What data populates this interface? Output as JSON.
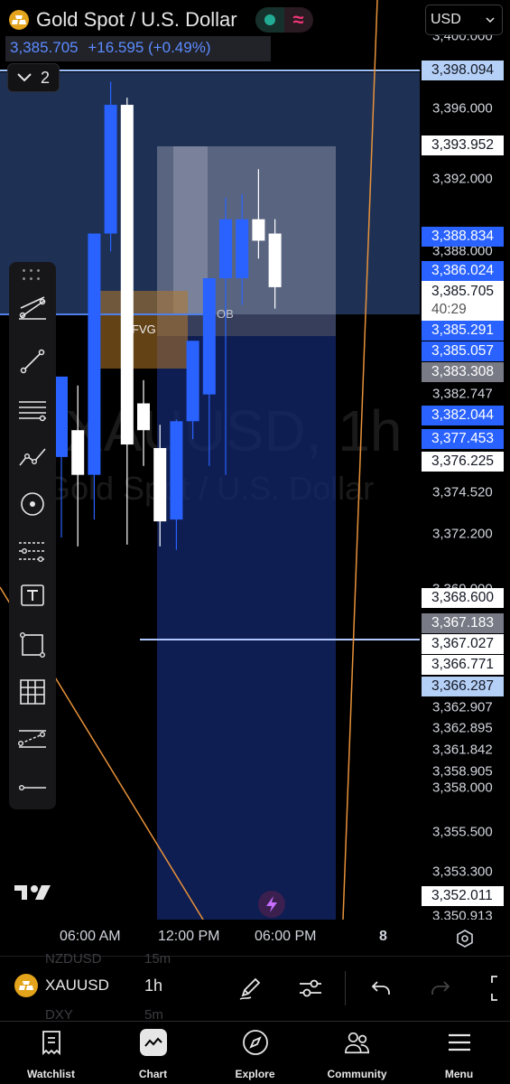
{
  "header": {
    "symbol_title": "Gold Spot / U.S. Dollar",
    "last_price": "3,385.705",
    "change": "+16.595 (+0.49%)",
    "indicator_count": "2",
    "wave_glyph": "≈"
  },
  "currency_select": {
    "value": "USD"
  },
  "watermark": {
    "main": "XAUUSD, 1h",
    "sub": "Gold Spot / U.S. Dollar"
  },
  "annotations": {
    "fvg": "FVG",
    "ob": "OB"
  },
  "price_axis": {
    "ticks": [
      "3,396.000",
      "3,392.000",
      "3,388.000",
      "3,382.747",
      "3,374.520",
      "3,372.200",
      "3,369.000",
      "3,366.000",
      "3,362.907",
      "3,362.895",
      "3,361.842",
      "3,358.905",
      "3,358.000",
      "3,355.500",
      "3,353.300",
      "3,350.913",
      "3,400.000"
    ],
    "tags": [
      "3,398.094",
      "3,393.952",
      "3,388.834",
      "3,386.024",
      "3,385.291",
      "3,385.057",
      "3,383.308",
      "3,382.044",
      "3,377.453",
      "3,376.225",
      "3,368.600",
      "3,367.183",
      "3,367.027",
      "3,366.771",
      "3,366.287",
      "3,352.011"
    ],
    "current_price": "3,385.705",
    "countdown": "40:29"
  },
  "time_axis": {
    "labels": [
      "06:00 AM",
      "12:00 PM",
      "06:00 PM"
    ],
    "date_marker": "8"
  },
  "bottom_toolbar": {
    "symbol": "XAUUSD",
    "interval": "1h",
    "ghost_symbol_1": "NZDUSD",
    "ghost_interval_1": "15m",
    "ghost_symbol_2": "DXY",
    "ghost_interval_2": "5m"
  },
  "nav": {
    "watchlist": "Watchlist",
    "chart": "Chart",
    "explore": "Explore",
    "community": "Community",
    "menu": "Menu"
  },
  "chart_data": {
    "type": "candlestick",
    "ylim": [
      3350.0,
      3400.0
    ],
    "candles": [
      {
        "o": 3376.5,
        "h": 3379.0,
        "l": 3372.0,
        "c": 3381.0
      },
      {
        "o": 3378.0,
        "h": 3380.5,
        "l": 3371.5,
        "c": 3375.5
      },
      {
        "o": 3375.5,
        "h": 3387.2,
        "l": 3373.0,
        "c": 3389.0
      },
      {
        "o": 3389.0,
        "h": 3397.5,
        "l": 3388.0,
        "c": 3396.2
      },
      {
        "o": 3396.2,
        "h": 3396.6,
        "l": 3371.6,
        "c": 3377.2
      },
      {
        "o": 3379.5,
        "h": 3380.8,
        "l": 3376.0,
        "c": 3378.0
      },
      {
        "o": 3377.0,
        "h": 3378.3,
        "l": 3371.5,
        "c": 3372.9
      },
      {
        "o": 3373.0,
        "h": 3378.6,
        "l": 3371.3,
        "c": 3378.5
      },
      {
        "o": 3378.5,
        "h": 3383.0,
        "l": 3377.5,
        "c": 3383.0
      },
      {
        "o": 3380.0,
        "h": 3386.0,
        "l": 3376.0,
        "c": 3386.5
      },
      {
        "o": 3386.5,
        "h": 3391.0,
        "l": 3375.5,
        "c": 3389.8
      },
      {
        "o": 3386.5,
        "h": 3391.2,
        "l": 3385.0,
        "c": 3389.8
      },
      {
        "o": 3389.8,
        "h": 3392.6,
        "l": 3387.6,
        "c": 3388.6
      },
      {
        "o": 3389.0,
        "h": 3389.8,
        "l": 3384.8,
        "c": 3386.0
      }
    ]
  }
}
